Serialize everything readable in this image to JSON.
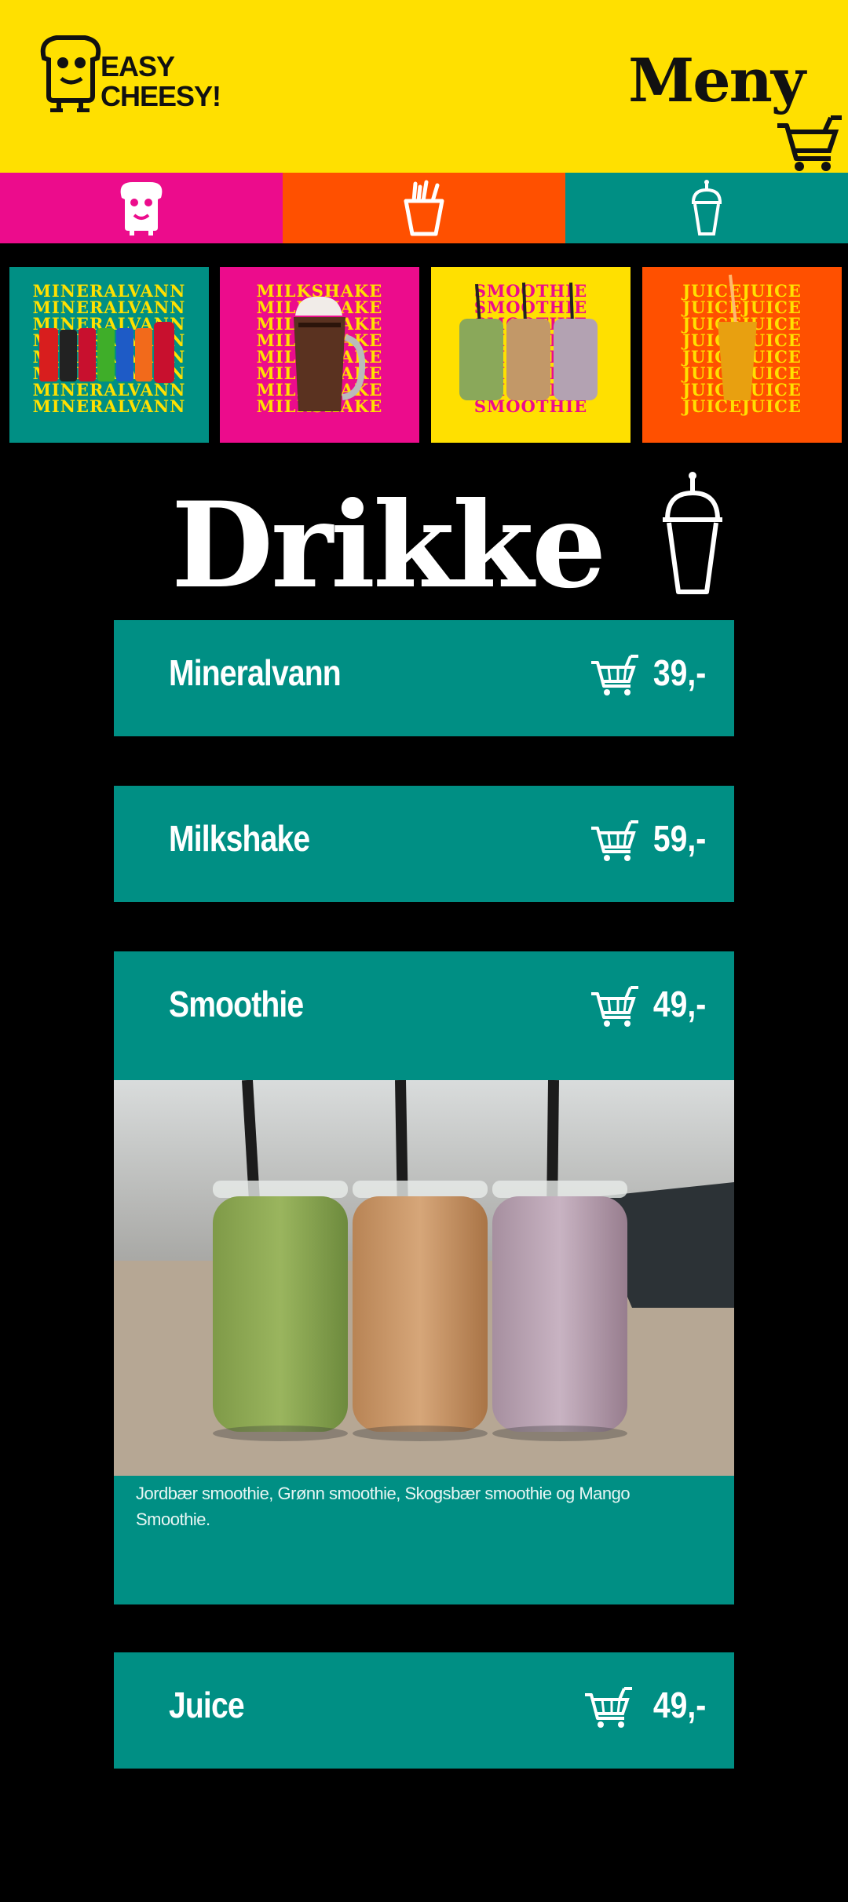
{
  "header": {
    "logo_line1": "EASY",
    "logo_line2": "CHEESY!",
    "title": "Meny"
  },
  "categories": [
    {
      "icon": "toast-icon",
      "color": "#ec0c8c"
    },
    {
      "icon": "fries-icon",
      "color": "#ff5000"
    },
    {
      "icon": "drink-icon",
      "color": "#008f84"
    }
  ],
  "thumbnails": [
    {
      "word": "MINERALVANN",
      "bg": "#008f84",
      "fg": "#ffe000"
    },
    {
      "word": "MILKSHAKE",
      "bg": "#ec0c8c",
      "fg": "#ffe000"
    },
    {
      "word": "SMOOTHIE",
      "bg": "#ffe000",
      "fg": "#ec0c8c"
    },
    {
      "word": "JUICE",
      "bg": "#ff5000",
      "fg": "#ffe000"
    }
  ],
  "section": {
    "title": "Drikke"
  },
  "items": [
    {
      "name": "Mineralvann",
      "price": "39,-"
    },
    {
      "name": "Milkshake",
      "price": "59,-"
    },
    {
      "name": "Smoothie",
      "price": "49,-",
      "description": "Jordbær smoothie, Grønn smoothie, Skogsbær smoothie og Mango Smoothie."
    },
    {
      "name": "Juice",
      "price": "49,-"
    }
  ]
}
